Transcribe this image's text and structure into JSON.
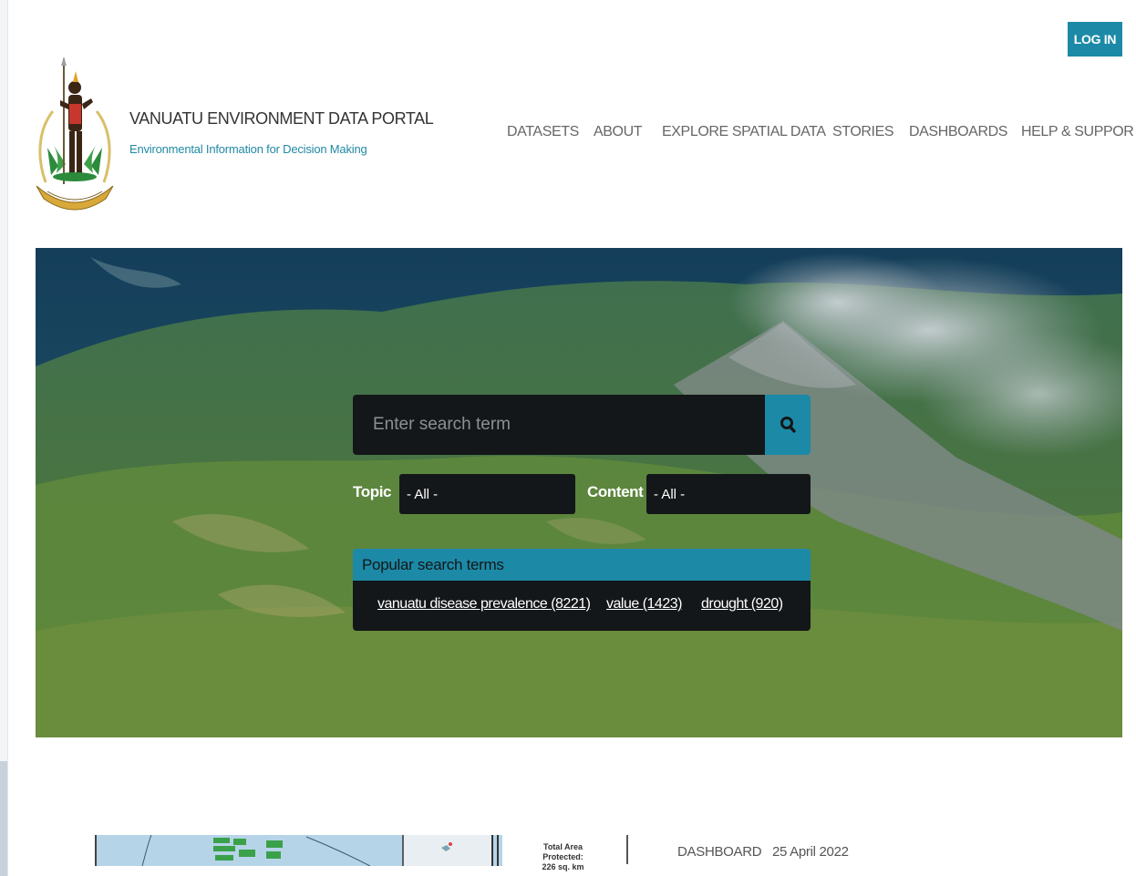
{
  "header": {
    "login_label": "LOG IN",
    "site_title": "VANUATU ENVIRONMENT DATA PORTAL",
    "tagline": "Environmental Information for Decision Making",
    "nav": [
      "DATASETS",
      "ABOUT",
      "EXPLORE SPATIAL DATA",
      "STORIES",
      "DASHBOARDS",
      "HELP & SUPPOR"
    ]
  },
  "search": {
    "placeholder": "Enter search term",
    "topic_label": "Topic",
    "topic_value": "- All -",
    "content_label": "Content",
    "content_value": "- All -",
    "button_icon": "search-icon"
  },
  "popular": {
    "title": "Popular search terms",
    "terms": [
      "vanuatu disease prevalence (8221)",
      "value (1423)",
      "drought (920)"
    ]
  },
  "featured": {
    "caption_line1": "Total Area Protected:",
    "caption_line2": "226 sq. km",
    "type": "DASHBOARD",
    "date": "25 April 2022"
  },
  "colors": {
    "accent": "#1c8aa7",
    "dark_panel": "#141719"
  }
}
